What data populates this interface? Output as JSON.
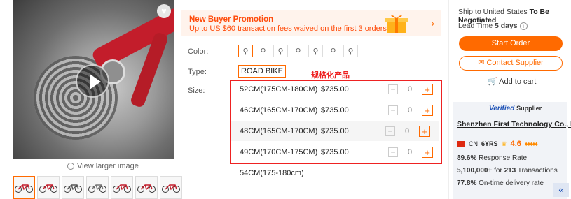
{
  "gallery": {
    "view_larger": "View larger image",
    "thumbnail_count": 7
  },
  "promo": {
    "title": "New Buyer Promotion",
    "subtitle": "Up to US $60 transaction fees waived on the first 3 orders"
  },
  "options": {
    "color_label": "Color:",
    "type_label": "Type:",
    "type_value": "ROAD BIKE",
    "size_label": "Size:",
    "annotation": "规格化产品"
  },
  "sizes": [
    {
      "name": "52CM(175CM-180CM)",
      "price": "$735.00",
      "qty": "0"
    },
    {
      "name": "46CM(165CM-170CM)",
      "price": "$735.00",
      "qty": "0"
    },
    {
      "name": "48CM(165CM-170CM)",
      "price": "$735.00",
      "qty": "0"
    },
    {
      "name": "49CM(170CM-175CM)",
      "price": "$735.00",
      "qty": "0"
    },
    {
      "name": "54CM(175-180cm)"
    }
  ],
  "shipping": {
    "prefix": "Ship to",
    "country": "United States",
    "status": "To Be Negotiated",
    "lead_label": "Lead Time",
    "lead_value": "5 days"
  },
  "actions": {
    "start_order": "Start Order",
    "contact_supplier": "Contact Supplier",
    "add_to_cart": "Add to cart"
  },
  "supplier": {
    "verified": "Verified",
    "verified_suffix": "Supplier",
    "company": "Shenzhen First Technology Co., L...",
    "country": "CN",
    "years": "6YRS",
    "rating": "4.6",
    "response_rate_value": "89.6%",
    "response_rate_label": "Response Rate",
    "transactions_value": "5,100,000+",
    "transactions_for": "for",
    "transactions_count": "213",
    "transactions_label": "Transactions",
    "ontime_value": "77.8%",
    "ontime_label": "On-time delivery rate"
  },
  "colors": {
    "accent": "#ff6a00",
    "annotation": "#e22222",
    "verified_blue": "#1a4fb5"
  }
}
